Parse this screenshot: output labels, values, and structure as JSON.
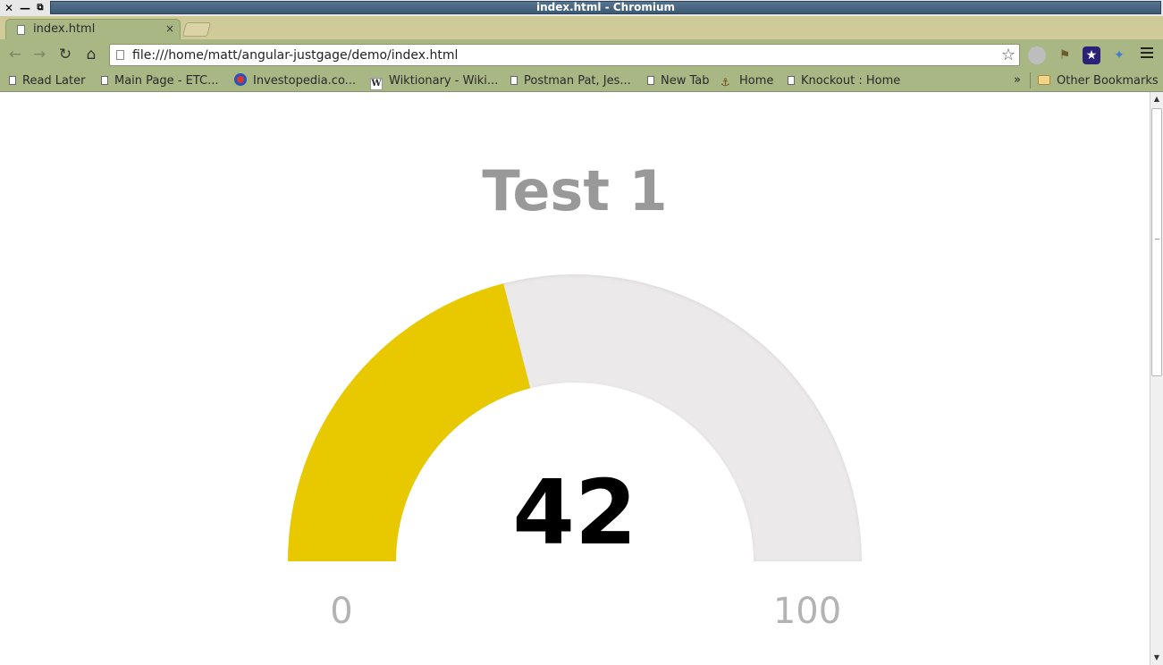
{
  "window": {
    "title": "index.html - Chromium",
    "controls": {
      "close": "✕",
      "minimize": "—",
      "restore": "⧉"
    }
  },
  "tabs": [
    {
      "label": "index.html",
      "close": "×",
      "active": true
    }
  ],
  "toolbar": {
    "back_icon": "arrow-left-icon",
    "forward_icon": "arrow-right-icon",
    "reload_icon": "reload-icon",
    "home_icon": "home-icon",
    "url": "file:///home/matt/angular-justgage/demo/index.html",
    "star_icon": "star-icon",
    "extensions": [
      "ghostery-icon",
      "flashlight-icon",
      "space-icon",
      "puzzle-icon"
    ]
  },
  "bookmarks": {
    "items": [
      {
        "label": "Read Later",
        "icon": "page-icon"
      },
      {
        "label": "Main Page - ETC...",
        "icon": "page-icon"
      },
      {
        "label": "Investopedia.co...",
        "icon": "investopedia-icon"
      },
      {
        "label": "Wiktionary - Wiki...",
        "icon": "wikipedia-icon"
      },
      {
        "label": "Postman Pat, Jes...",
        "icon": "page-icon"
      },
      {
        "label": "New Tab",
        "icon": "page-icon"
      },
      {
        "label": "Home",
        "icon": "home-icon"
      },
      {
        "label": "Knockout : Home",
        "icon": "page-icon"
      }
    ],
    "overflow": "»",
    "other": {
      "label": "Other Bookmarks",
      "icon": "folder-icon"
    }
  },
  "gauge": {
    "title": "Test 1",
    "value": "42",
    "min": "0",
    "max": "100",
    "value_fraction": 0.42,
    "level_color": "#e8c900",
    "track_color": "#ebe9ea",
    "title_color": "#999999",
    "value_color": "#000000",
    "label_color": "#b3b3b3"
  }
}
